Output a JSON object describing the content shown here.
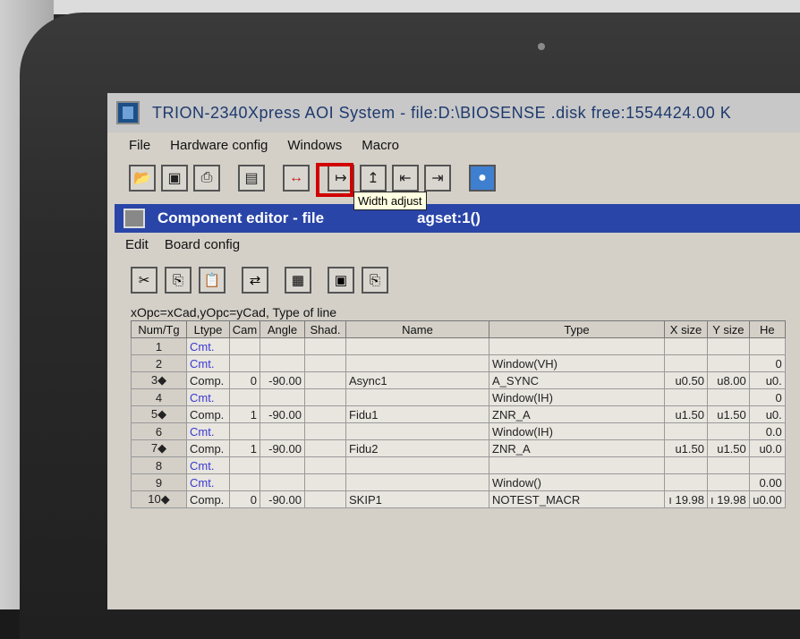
{
  "app": {
    "title": "TRION-2340Xpress AOI System - file:D:\\BIOSENSE .disk free:1554424.00 K"
  },
  "menu": [
    {
      "label": "File"
    },
    {
      "label": "Hardware config"
    },
    {
      "label": "Windows"
    },
    {
      "label": "Macro"
    }
  ],
  "toolbar": {
    "tooltip": "Width adjust"
  },
  "child_window": {
    "title": "Component editor - file",
    "title_tail": "agset:1()",
    "menu": [
      {
        "label": "Edit"
      },
      {
        "label": "Board config"
      }
    ]
  },
  "status_line": "xOpc=xCad,yOpc=yCad,  Type of line",
  "table": {
    "headers": [
      "Num/Tg",
      "Ltype",
      "Cam",
      "Angle",
      "Shad.",
      "Name",
      "Type",
      "X size",
      "Y size",
      "He"
    ],
    "rows": [
      {
        "num": "1",
        "ltype": "Cmt.",
        "cam": "",
        "angle": "",
        "shad": "",
        "name": "",
        "type": "",
        "xsize": "",
        "ysize": "",
        "he": ""
      },
      {
        "num": "2",
        "ltype": "Cmt.",
        "cam": "",
        "angle": "",
        "shad": "",
        "name": "",
        "type": "Window(VH)",
        "xsize": "",
        "ysize": "",
        "he": "0"
      },
      {
        "num": "3◆",
        "ltype": "Comp.",
        "cam": "0",
        "angle": "-90.00",
        "shad": "",
        "name": "Async1",
        "type": "A_SYNC",
        "xsize": "u0.50",
        "ysize": "u8.00",
        "he": "u0."
      },
      {
        "num": "4",
        "ltype": "Cmt.",
        "cam": "",
        "angle": "",
        "shad": "",
        "name": "",
        "type": "Window(IH)",
        "xsize": "",
        "ysize": "",
        "he": "0"
      },
      {
        "num": "5◆",
        "ltype": "Comp.",
        "cam": "1",
        "angle": "-90.00",
        "shad": "",
        "name": "Fidu1",
        "type": "ZNR_A",
        "xsize": "u1.50",
        "ysize": "u1.50",
        "he": "u0."
      },
      {
        "num": "6",
        "ltype": "Cmt.",
        "cam": "",
        "angle": "",
        "shad": "",
        "name": "",
        "type": "Window(IH)",
        "xsize": "",
        "ysize": "",
        "he": "0.0"
      },
      {
        "num": "7◆",
        "ltype": "Comp.",
        "cam": "1",
        "angle": "-90.00",
        "shad": "",
        "name": "Fidu2",
        "type": "ZNR_A",
        "xsize": "u1.50",
        "ysize": "u1.50",
        "he": "u0.0"
      },
      {
        "num": "8",
        "ltype": "Cmt.",
        "cam": "",
        "angle": "",
        "shad": "",
        "name": "",
        "type": "",
        "xsize": "",
        "ysize": "",
        "he": ""
      },
      {
        "num": "9",
        "ltype": "Cmt.",
        "cam": "",
        "angle": "",
        "shad": "",
        "name": "",
        "type": "Window()",
        "xsize": "",
        "ysize": "",
        "he": "0.00"
      },
      {
        "num": "10◆",
        "ltype": "Comp.",
        "cam": "0",
        "angle": "-90.00",
        "shad": "",
        "name": "SKIP1",
        "type": "NOTEST_MACR",
        "xsize": "ı 19.98",
        "ysize": "ı 19.98",
        "he": "u0.00"
      }
    ]
  }
}
